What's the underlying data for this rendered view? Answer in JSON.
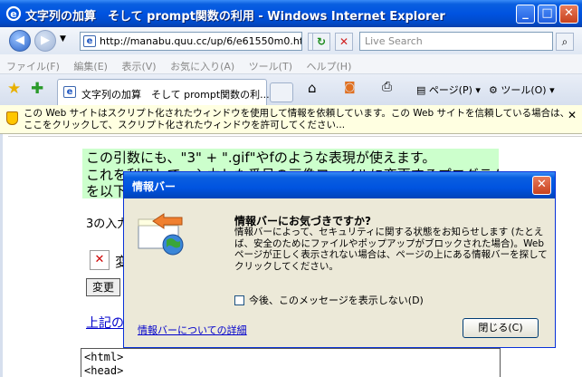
{
  "window": {
    "title": "文字列の加算　そして prompt関数の利用 - Windows Internet Explorer",
    "buttons": {
      "minimize": "_",
      "maximize": "□",
      "close": "✕"
    }
  },
  "addressbar": {
    "url": "http://manabu.quu.cc/up/6/e61550m0.htm",
    "search_placeholder": "Live Search"
  },
  "menu": [
    "ファイル(F)",
    "編集(E)",
    "表示(V)",
    "お気に入り(A)",
    "ツール(T)",
    "ヘルプ(H)"
  ],
  "tab": {
    "label": "文字列の加算　そして prompt関数の利..."
  },
  "toolbar": {
    "page_label": "ページ(P)",
    "tools_label": "ツール(O)"
  },
  "infobar": {
    "message": "この Web サイトはスクリプト化されたウィンドウを使用して情報を依頼しています。この Web サイトを信頼している場合は、ここをクリックして、スクリプト化されたウィンドウを許可してください..."
  },
  "page": {
    "line1": "この引数にも、\"3\" + \".gif\"やfのような表現が使えます。",
    "line2": "これを利用して、入力した番号の画像ファイルに変更するプログラム",
    "line3": "を以下",
    "line4": "3の入力",
    "img_label": "変",
    "button_label": "変更",
    "link_text": "上記の",
    "code": [
      "<html>",
      "<head>"
    ]
  },
  "dialog": {
    "title": "情報バー",
    "heading": "情報バーにお気づきですか?",
    "body": "情報バーによって、セキュリティに関する状態をお知らせします (たとえば、安全のためにファイルやポップアップがブロックされた場合)。Web ページが正しく表示されない場合は、ページの上にある情報バーを探してクリックしてください。",
    "checkbox_label": "今後、このメッセージを表示しない(D)",
    "help_link": "情報バーについての詳細",
    "close_button": "閉じる(C)"
  }
}
